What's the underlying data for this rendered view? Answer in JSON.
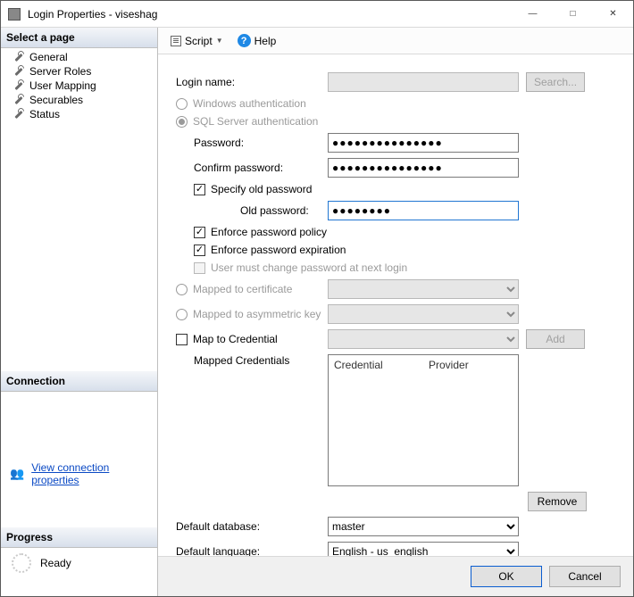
{
  "window": {
    "title": "Login Properties - viseshag"
  },
  "sidebar": {
    "select_page": "Select a page",
    "items": [
      {
        "label": "General"
      },
      {
        "label": "Server Roles"
      },
      {
        "label": "User Mapping"
      },
      {
        "label": "Securables"
      },
      {
        "label": "Status"
      }
    ],
    "connection_head": "Connection",
    "view_conn": "View connection properties",
    "progress_head": "Progress",
    "progress_status": "Ready"
  },
  "toolbar": {
    "script": "Script",
    "help": "Help"
  },
  "form": {
    "login_name_lbl": "Login name:",
    "login_name_val": "",
    "search_btn": "Search...",
    "win_auth": "Windows authentication",
    "sql_auth": "SQL Server authentication",
    "password_lbl": "Password:",
    "password_val": "●●●●●●●●●●●●●●●",
    "confirm_lbl": "Confirm password:",
    "confirm_val": "●●●●●●●●●●●●●●●",
    "specify_old": "Specify old password",
    "old_pw_lbl": "Old password:",
    "old_pw_val": "●●●●●●●●",
    "enforce_policy": "Enforce password policy",
    "enforce_exp": "Enforce password expiration",
    "must_change": "User must change password at next login",
    "mapped_cert": "Mapped to certificate",
    "mapped_asym": "Mapped to asymmetric key",
    "map_cred": "Map to Credential",
    "add_btn": "Add",
    "mapped_creds_lbl": "Mapped Credentials",
    "cred_col1": "Credential",
    "cred_col2": "Provider",
    "remove_btn": "Remove",
    "def_db_lbl": "Default database:",
    "def_db_val": "master",
    "def_lang_lbl": "Default language:",
    "def_lang_val": "English - us_english"
  },
  "footer": {
    "ok": "OK",
    "cancel": "Cancel"
  }
}
